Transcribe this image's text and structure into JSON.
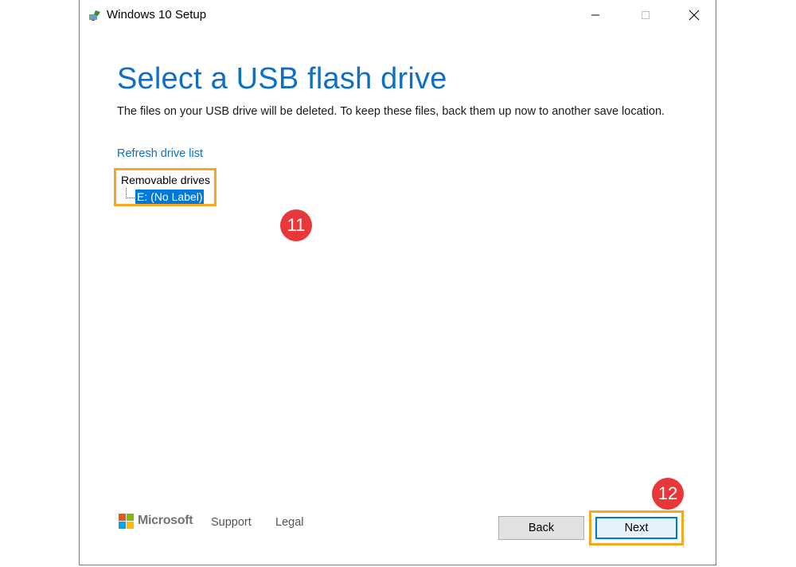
{
  "window": {
    "title": "Windows 10 Setup",
    "app_icon": "windows-setup-icon",
    "controls": [
      "minimize-icon",
      "maximize-icon",
      "close-icon"
    ]
  },
  "main": {
    "heading": "Select a USB flash drive",
    "subtitle": "The files on your USB drive will be deleted. To keep these files, back them up now to another save location.",
    "refresh_link": "Refresh drive list",
    "tree": {
      "root_label": "Removable drives",
      "items": [
        {
          "label": "E: (No Label)",
          "selected": true
        }
      ]
    }
  },
  "annotations": {
    "step_11": "11",
    "step_12": "12"
  },
  "footer": {
    "brand": "Microsoft",
    "support_label": "Support",
    "legal_label": "Legal",
    "back_label": "Back",
    "next_label": "Next"
  },
  "colors": {
    "accent": "#0f6fc4",
    "selection": "#0078d7",
    "highlight_frame": "#f5a623",
    "badge": "#e8373a"
  }
}
